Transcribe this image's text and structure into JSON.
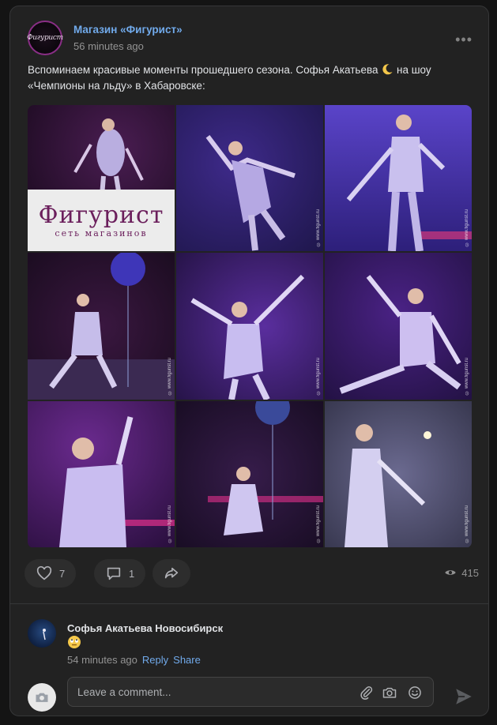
{
  "post": {
    "author": "Магазин «Фигурист»",
    "time": "56 minutes ago",
    "avatar_text": "Фигурист",
    "text_part1": "Вспоминаем красивые моменты прошедшего сезона. Софья Акатьева ",
    "text_part2": " на шоу «Чемпионы на льду» в Хабаровске:",
    "more_icon": "more-horizontal-icon"
  },
  "photos": {
    "watermark": "© www.figurist.ru",
    "banner_big": "Фигурист",
    "banner_small": "сеть магазинов"
  },
  "actions": {
    "likes": "7",
    "comments": "1",
    "views": "415"
  },
  "comment": {
    "author": "Софья Акатьева Новосибирск",
    "time": "54 minutes ago",
    "reply": "Reply",
    "share": "Share"
  },
  "composer": {
    "placeholder": "Leave a comment..."
  },
  "colors": {
    "accent": "#71aaeb",
    "card_bg": "#222222",
    "page_bg": "#141414"
  }
}
